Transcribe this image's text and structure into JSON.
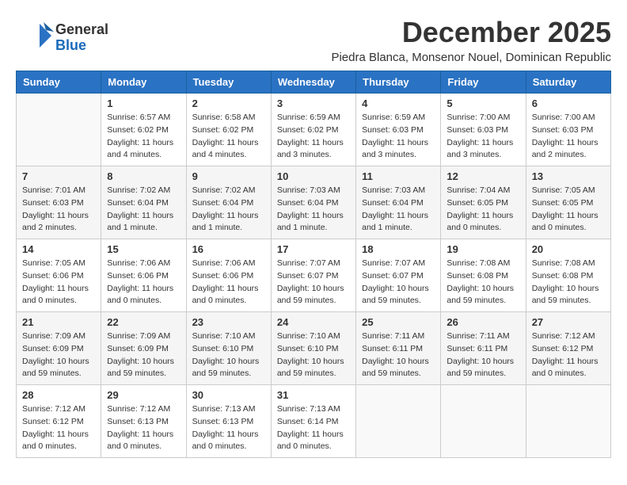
{
  "logo": {
    "general": "General",
    "blue": "Blue"
  },
  "title": "December 2025",
  "subtitle": "Piedra Blanca, Monsenor Nouel, Dominican Republic",
  "headers": [
    "Sunday",
    "Monday",
    "Tuesday",
    "Wednesday",
    "Thursday",
    "Friday",
    "Saturday"
  ],
  "weeks": [
    [
      {
        "day": "",
        "sunrise": "",
        "sunset": "",
        "daylight": ""
      },
      {
        "day": "1",
        "sunrise": "Sunrise: 6:57 AM",
        "sunset": "Sunset: 6:02 PM",
        "daylight": "Daylight: 11 hours and 4 minutes."
      },
      {
        "day": "2",
        "sunrise": "Sunrise: 6:58 AM",
        "sunset": "Sunset: 6:02 PM",
        "daylight": "Daylight: 11 hours and 4 minutes."
      },
      {
        "day": "3",
        "sunrise": "Sunrise: 6:59 AM",
        "sunset": "Sunset: 6:02 PM",
        "daylight": "Daylight: 11 hours and 3 minutes."
      },
      {
        "day": "4",
        "sunrise": "Sunrise: 6:59 AM",
        "sunset": "Sunset: 6:03 PM",
        "daylight": "Daylight: 11 hours and 3 minutes."
      },
      {
        "day": "5",
        "sunrise": "Sunrise: 7:00 AM",
        "sunset": "Sunset: 6:03 PM",
        "daylight": "Daylight: 11 hours and 3 minutes."
      },
      {
        "day": "6",
        "sunrise": "Sunrise: 7:00 AM",
        "sunset": "Sunset: 6:03 PM",
        "daylight": "Daylight: 11 hours and 2 minutes."
      }
    ],
    [
      {
        "day": "7",
        "sunrise": "Sunrise: 7:01 AM",
        "sunset": "Sunset: 6:03 PM",
        "daylight": "Daylight: 11 hours and 2 minutes."
      },
      {
        "day": "8",
        "sunrise": "Sunrise: 7:02 AM",
        "sunset": "Sunset: 6:04 PM",
        "daylight": "Daylight: 11 hours and 1 minute."
      },
      {
        "day": "9",
        "sunrise": "Sunrise: 7:02 AM",
        "sunset": "Sunset: 6:04 PM",
        "daylight": "Daylight: 11 hours and 1 minute."
      },
      {
        "day": "10",
        "sunrise": "Sunrise: 7:03 AM",
        "sunset": "Sunset: 6:04 PM",
        "daylight": "Daylight: 11 hours and 1 minute."
      },
      {
        "day": "11",
        "sunrise": "Sunrise: 7:03 AM",
        "sunset": "Sunset: 6:04 PM",
        "daylight": "Daylight: 11 hours and 1 minute."
      },
      {
        "day": "12",
        "sunrise": "Sunrise: 7:04 AM",
        "sunset": "Sunset: 6:05 PM",
        "daylight": "Daylight: 11 hours and 0 minutes."
      },
      {
        "day": "13",
        "sunrise": "Sunrise: 7:05 AM",
        "sunset": "Sunset: 6:05 PM",
        "daylight": "Daylight: 11 hours and 0 minutes."
      }
    ],
    [
      {
        "day": "14",
        "sunrise": "Sunrise: 7:05 AM",
        "sunset": "Sunset: 6:06 PM",
        "daylight": "Daylight: 11 hours and 0 minutes."
      },
      {
        "day": "15",
        "sunrise": "Sunrise: 7:06 AM",
        "sunset": "Sunset: 6:06 PM",
        "daylight": "Daylight: 11 hours and 0 minutes."
      },
      {
        "day": "16",
        "sunrise": "Sunrise: 7:06 AM",
        "sunset": "Sunset: 6:06 PM",
        "daylight": "Daylight: 11 hours and 0 minutes."
      },
      {
        "day": "17",
        "sunrise": "Sunrise: 7:07 AM",
        "sunset": "Sunset: 6:07 PM",
        "daylight": "Daylight: 10 hours and 59 minutes."
      },
      {
        "day": "18",
        "sunrise": "Sunrise: 7:07 AM",
        "sunset": "Sunset: 6:07 PM",
        "daylight": "Daylight: 10 hours and 59 minutes."
      },
      {
        "day": "19",
        "sunrise": "Sunrise: 7:08 AM",
        "sunset": "Sunset: 6:08 PM",
        "daylight": "Daylight: 10 hours and 59 minutes."
      },
      {
        "day": "20",
        "sunrise": "Sunrise: 7:08 AM",
        "sunset": "Sunset: 6:08 PM",
        "daylight": "Daylight: 10 hours and 59 minutes."
      }
    ],
    [
      {
        "day": "21",
        "sunrise": "Sunrise: 7:09 AM",
        "sunset": "Sunset: 6:09 PM",
        "daylight": "Daylight: 10 hours and 59 minutes."
      },
      {
        "day": "22",
        "sunrise": "Sunrise: 7:09 AM",
        "sunset": "Sunset: 6:09 PM",
        "daylight": "Daylight: 10 hours and 59 minutes."
      },
      {
        "day": "23",
        "sunrise": "Sunrise: 7:10 AM",
        "sunset": "Sunset: 6:10 PM",
        "daylight": "Daylight: 10 hours and 59 minutes."
      },
      {
        "day": "24",
        "sunrise": "Sunrise: 7:10 AM",
        "sunset": "Sunset: 6:10 PM",
        "daylight": "Daylight: 10 hours and 59 minutes."
      },
      {
        "day": "25",
        "sunrise": "Sunrise: 7:11 AM",
        "sunset": "Sunset: 6:11 PM",
        "daylight": "Daylight: 10 hours and 59 minutes."
      },
      {
        "day": "26",
        "sunrise": "Sunrise: 7:11 AM",
        "sunset": "Sunset: 6:11 PM",
        "daylight": "Daylight: 10 hours and 59 minutes."
      },
      {
        "day": "27",
        "sunrise": "Sunrise: 7:12 AM",
        "sunset": "Sunset: 6:12 PM",
        "daylight": "Daylight: 11 hours and 0 minutes."
      }
    ],
    [
      {
        "day": "28",
        "sunrise": "Sunrise: 7:12 AM",
        "sunset": "Sunset: 6:12 PM",
        "daylight": "Daylight: 11 hours and 0 minutes."
      },
      {
        "day": "29",
        "sunrise": "Sunrise: 7:12 AM",
        "sunset": "Sunset: 6:13 PM",
        "daylight": "Daylight: 11 hours and 0 minutes."
      },
      {
        "day": "30",
        "sunrise": "Sunrise: 7:13 AM",
        "sunset": "Sunset: 6:13 PM",
        "daylight": "Daylight: 11 hours and 0 minutes."
      },
      {
        "day": "31",
        "sunrise": "Sunrise: 7:13 AM",
        "sunset": "Sunset: 6:14 PM",
        "daylight": "Daylight: 11 hours and 0 minutes."
      },
      {
        "day": "",
        "sunrise": "",
        "sunset": "",
        "daylight": ""
      },
      {
        "day": "",
        "sunrise": "",
        "sunset": "",
        "daylight": ""
      },
      {
        "day": "",
        "sunrise": "",
        "sunset": "",
        "daylight": ""
      }
    ]
  ]
}
